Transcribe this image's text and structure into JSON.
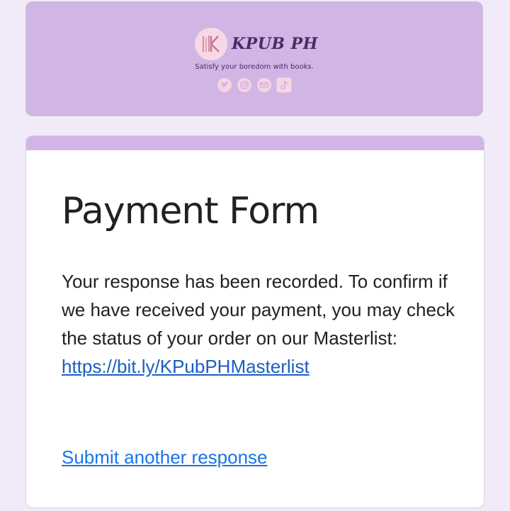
{
  "header": {
    "brand_name": "KPUB PH",
    "tagline": "Satisfy your boredom with books.",
    "logo_letter": "K",
    "social_icons": [
      "twitter-icon",
      "instagram-icon",
      "email-icon",
      "tiktok-icon"
    ]
  },
  "form": {
    "title": "Payment Form",
    "message_text": "Your response has been recorded. To confirm if we have received your payment, you may check the status of your order on our Masterlist:",
    "masterlist_link": "https://bit.ly/KPubPHMasterlist",
    "submit_another_label": "Submit another response"
  },
  "colors": {
    "background": "#f1eaf8",
    "header_card": "#d1b5e5",
    "accent_bar": "#d1b5e5",
    "brand_text": "#4b2a66",
    "link": "#1a73e8",
    "social_icon": "#f8d3e3"
  }
}
